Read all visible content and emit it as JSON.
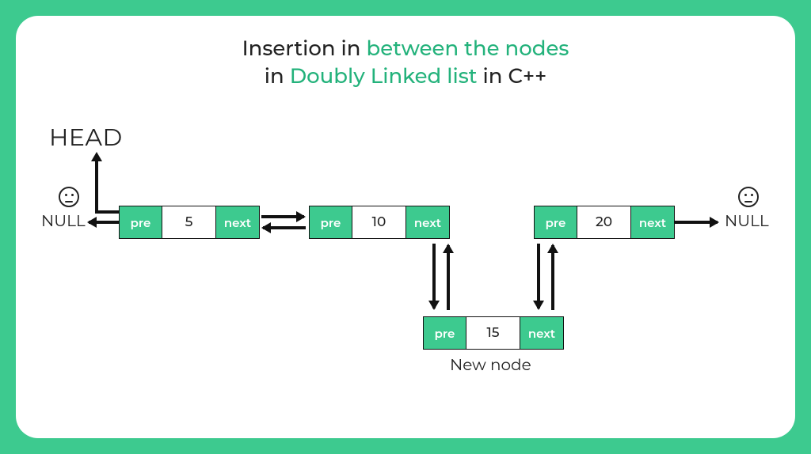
{
  "title": {
    "part1": "Insertion in ",
    "accent1": "between the nodes",
    "part2": "in ",
    "accent2": "Doubly Linked list",
    "part3": " in C++"
  },
  "labels": {
    "head": "HEAD",
    "null_left": "NULL",
    "null_right": "NULL",
    "new_node": "New node",
    "pre": "pre",
    "next": "next"
  },
  "nodes": {
    "n1": {
      "value": "5"
    },
    "n2": {
      "value": "10"
    },
    "n3": {
      "value": "20"
    },
    "new": {
      "value": "15"
    }
  },
  "colors": {
    "accent": "#3dca8f",
    "text_accent": "#23b27b"
  }
}
